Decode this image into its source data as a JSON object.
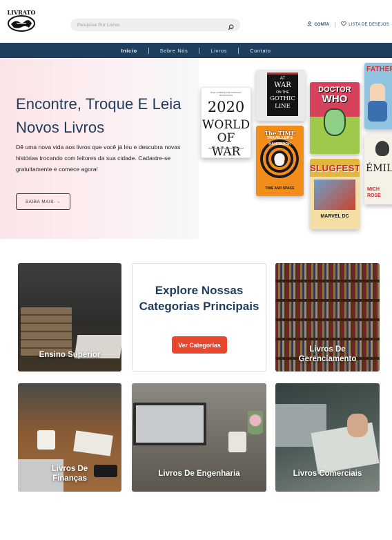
{
  "brand": {
    "logo_text": "LIVRATO",
    "accent": "#e8472d",
    "navy": "#1e3e60"
  },
  "search": {
    "placeholder": "Pesquise Por Livros",
    "icon": "search-icon"
  },
  "header": {
    "account_label": "CONTA",
    "wishlist_label": "LISTA DE DESEJOS"
  },
  "nav": {
    "items": [
      {
        "label": "Início",
        "active": true
      },
      {
        "label": "Sobre Nós"
      },
      {
        "label": "Livros"
      },
      {
        "label": "Contato"
      }
    ]
  },
  "hero": {
    "title": "Encontre, Troque E Leia Novos Livros",
    "text": "Dê uma nova vida aos livros que você já leu e descubra novas histórias trocando com leitores da sua cidade. Cadastre-se gratuitamente e comece agora!",
    "button_label": "SAIBA MAIS",
    "button_arrow": "→",
    "covers": {
      "war2020": {
        "top": "PAUL CORNISH AND KINGSLEY DONALDSON",
        "year": "2020",
        "line1": "WORLD",
        "line2": "OF WAR"
      },
      "gothic": {
        "l1": "AT",
        "l2": "WAR",
        "l3": "ON THE",
        "l4": "GOTHIC",
        "l5": "LINE"
      },
      "doctor": {
        "line1": "DOCTOR",
        "line2": "WHO"
      },
      "time": {
        "line1": "The TIME",
        "line2": "TRAVELLER'S",
        "line3": "HANDBOOK",
        "bottom": "TIME AND SPACE"
      },
      "slugfest": {
        "title": "SLUGFEST",
        "bottom": "MARVEL DC"
      },
      "fathers": {
        "title": "FATHER"
      },
      "emile": {
        "title": "ÉMILE",
        "author": "MICH ROSE"
      }
    }
  },
  "categories": {
    "heading": "Explore Nossas Categorias Principais",
    "button_label": "Ver Categorias",
    "tiles": [
      {
        "label": "Ensino Superior"
      },
      {
        "label": "Livros De Gerenciamento"
      },
      {
        "label": "Livros De Finanças"
      },
      {
        "label": "Livros De Engenharia"
      },
      {
        "label": "Livros Comerciais"
      }
    ]
  }
}
